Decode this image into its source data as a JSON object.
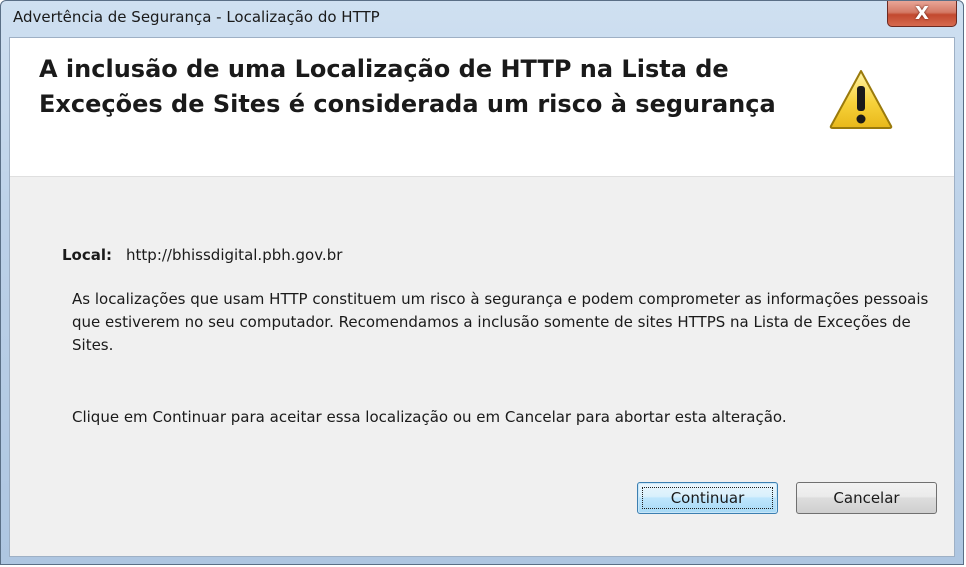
{
  "window": {
    "title": "Advertência de Segurança - Localização do HTTP",
    "close_label": "X"
  },
  "header": {
    "headline": "A inclusão de uma Localização de HTTP na Lista de Exceções de Sites é considerada um risco à segurança",
    "icon": "warning-icon"
  },
  "location": {
    "label": "Local:",
    "value": "http://bhissdigital.pbh.gov.br"
  },
  "message": {
    "paragraph1": "As localizações que usam HTTP constituem um risco à segurança e podem comprometer as informações pessoais que estiverem no seu computador. Recomendamos a inclusão somente de sites HTTPS na Lista de Exceções de Sites.",
    "paragraph2": "Clique em Continuar para aceitar essa localização ou em Cancelar para abortar esta alteração."
  },
  "buttons": {
    "continue_label": "Continuar",
    "cancel_label": "Cancelar"
  },
  "colors": {
    "warning_yellow": "#f7d23b",
    "close_red": "#c2492f",
    "default_button_border": "#3c7fb1"
  }
}
